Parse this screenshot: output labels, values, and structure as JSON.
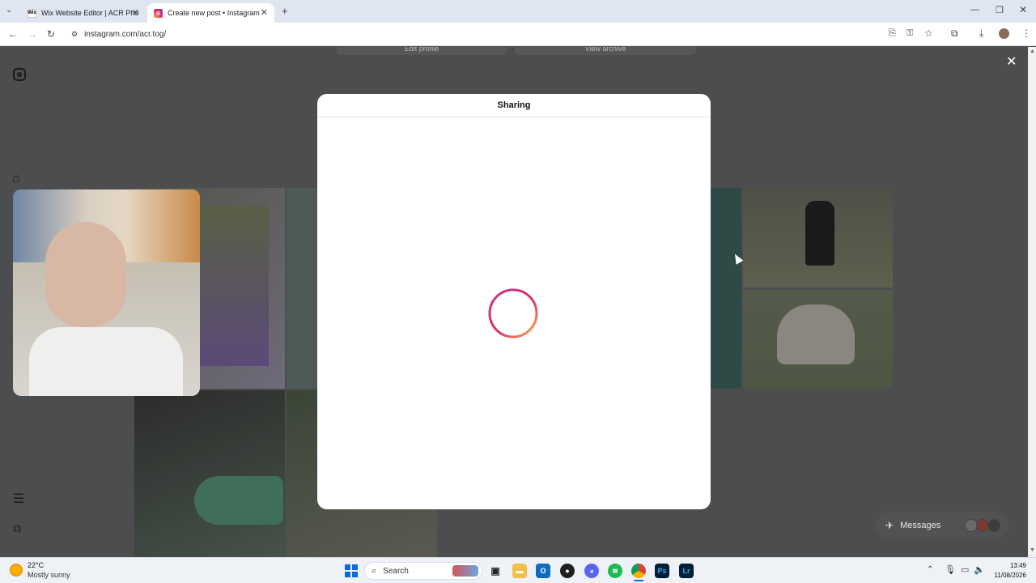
{
  "browser": {
    "tabs": [
      {
        "label": "Wix Website Editor | ACR Photo",
        "favicon": "Wix",
        "active": false
      },
      {
        "label": "Create new post • Instagram",
        "favicon": "ig",
        "active": true
      }
    ],
    "url": "instagram.com/acr.tog/"
  },
  "profile_page": {
    "edit_profile": "Edit profile",
    "view_archive": "View archive"
  },
  "modal": {
    "title": "Sharing"
  },
  "messages": {
    "label": "Messages"
  },
  "taskbar": {
    "weather_temp": "22°C",
    "weather_desc": "Mostly sunny",
    "search_placeholder": "Search",
    "time": "13:49",
    "date": "11/08/2026"
  },
  "colors": {
    "spinner_start": "#c13584",
    "spinner_mid": "#e1306c",
    "spinner_end": "#fcaf45",
    "overlay": "#4b4d4e"
  },
  "icons": {
    "sidebar": [
      "instagram-logo-icon",
      "home-icon",
      "menu-icon",
      "more-grid-icon"
    ],
    "close": "close-icon"
  }
}
